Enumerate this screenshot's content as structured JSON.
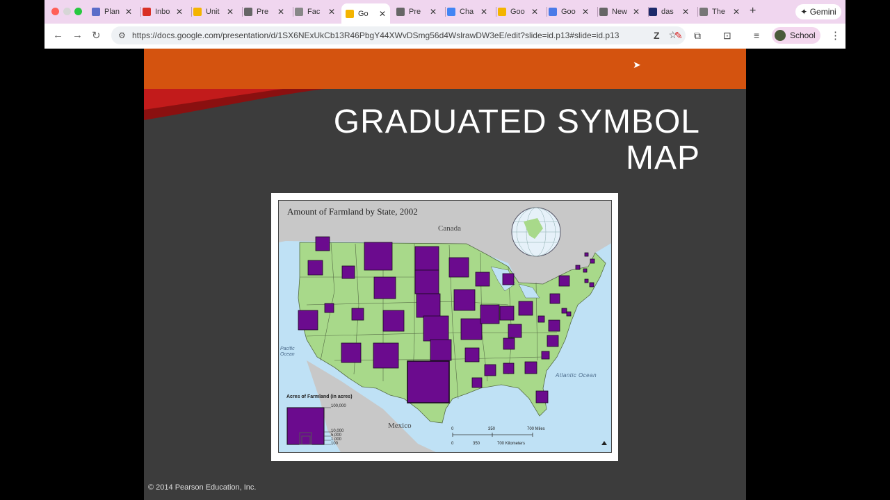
{
  "browser": {
    "tabs": [
      {
        "label": "Plan",
        "color": "#5b6dc9"
      },
      {
        "label": "Inbox",
        "color": "#d93025"
      },
      {
        "label": "Unit",
        "color": "#f4b400"
      },
      {
        "label": "Pre",
        "color": "#666666"
      },
      {
        "label": "Fac",
        "color": "#888888"
      },
      {
        "label": "Go",
        "color": "#f4b400"
      },
      {
        "label": "Pre",
        "color": "#666666"
      },
      {
        "label": "Cha",
        "color": "#4285f4"
      },
      {
        "label": "Goo",
        "color": "#f4b400"
      },
      {
        "label": "Goo",
        "color": "#4a7ae8"
      },
      {
        "label": "New",
        "color": "#666666"
      },
      {
        "label": "das",
        "color": "#1d2a6b"
      },
      {
        "label": "The",
        "color": "#777777"
      }
    ],
    "gemini_label": "Gemini",
    "url": "https://docs.google.com/presentation/d/1SX6NExUkCb13R46PbgY44XWvDSmg56d4WslrawDW3eE/edit?slide=id.p13#slide=id.p13",
    "profile_label": "School"
  },
  "slide": {
    "title_line1": "GRADUATED SYMBOL",
    "title_line2": "MAP",
    "copyright": "© 2014 Pearson Education, Inc.",
    "map": {
      "title": "Amount of Farmland by State, 2002",
      "canada": "Canada",
      "mexico": "Mexico",
      "pacific": "Pacific Ocean",
      "atlantic": "Atlantic Ocean",
      "legend_title": "Acres of Farmland (in acres)",
      "legend_values": [
        "100,000",
        "10,000",
        "5,000",
        "1,000",
        "100"
      ],
      "scale_miles": [
        "0",
        "350",
        "700 Miles"
      ],
      "scale_km": [
        "0",
        "350",
        "700 Kilometers"
      ],
      "symbol_color": "#6b0b8e",
      "land_color": "#a8d98a",
      "water_color": "#bfe1f5"
    }
  }
}
